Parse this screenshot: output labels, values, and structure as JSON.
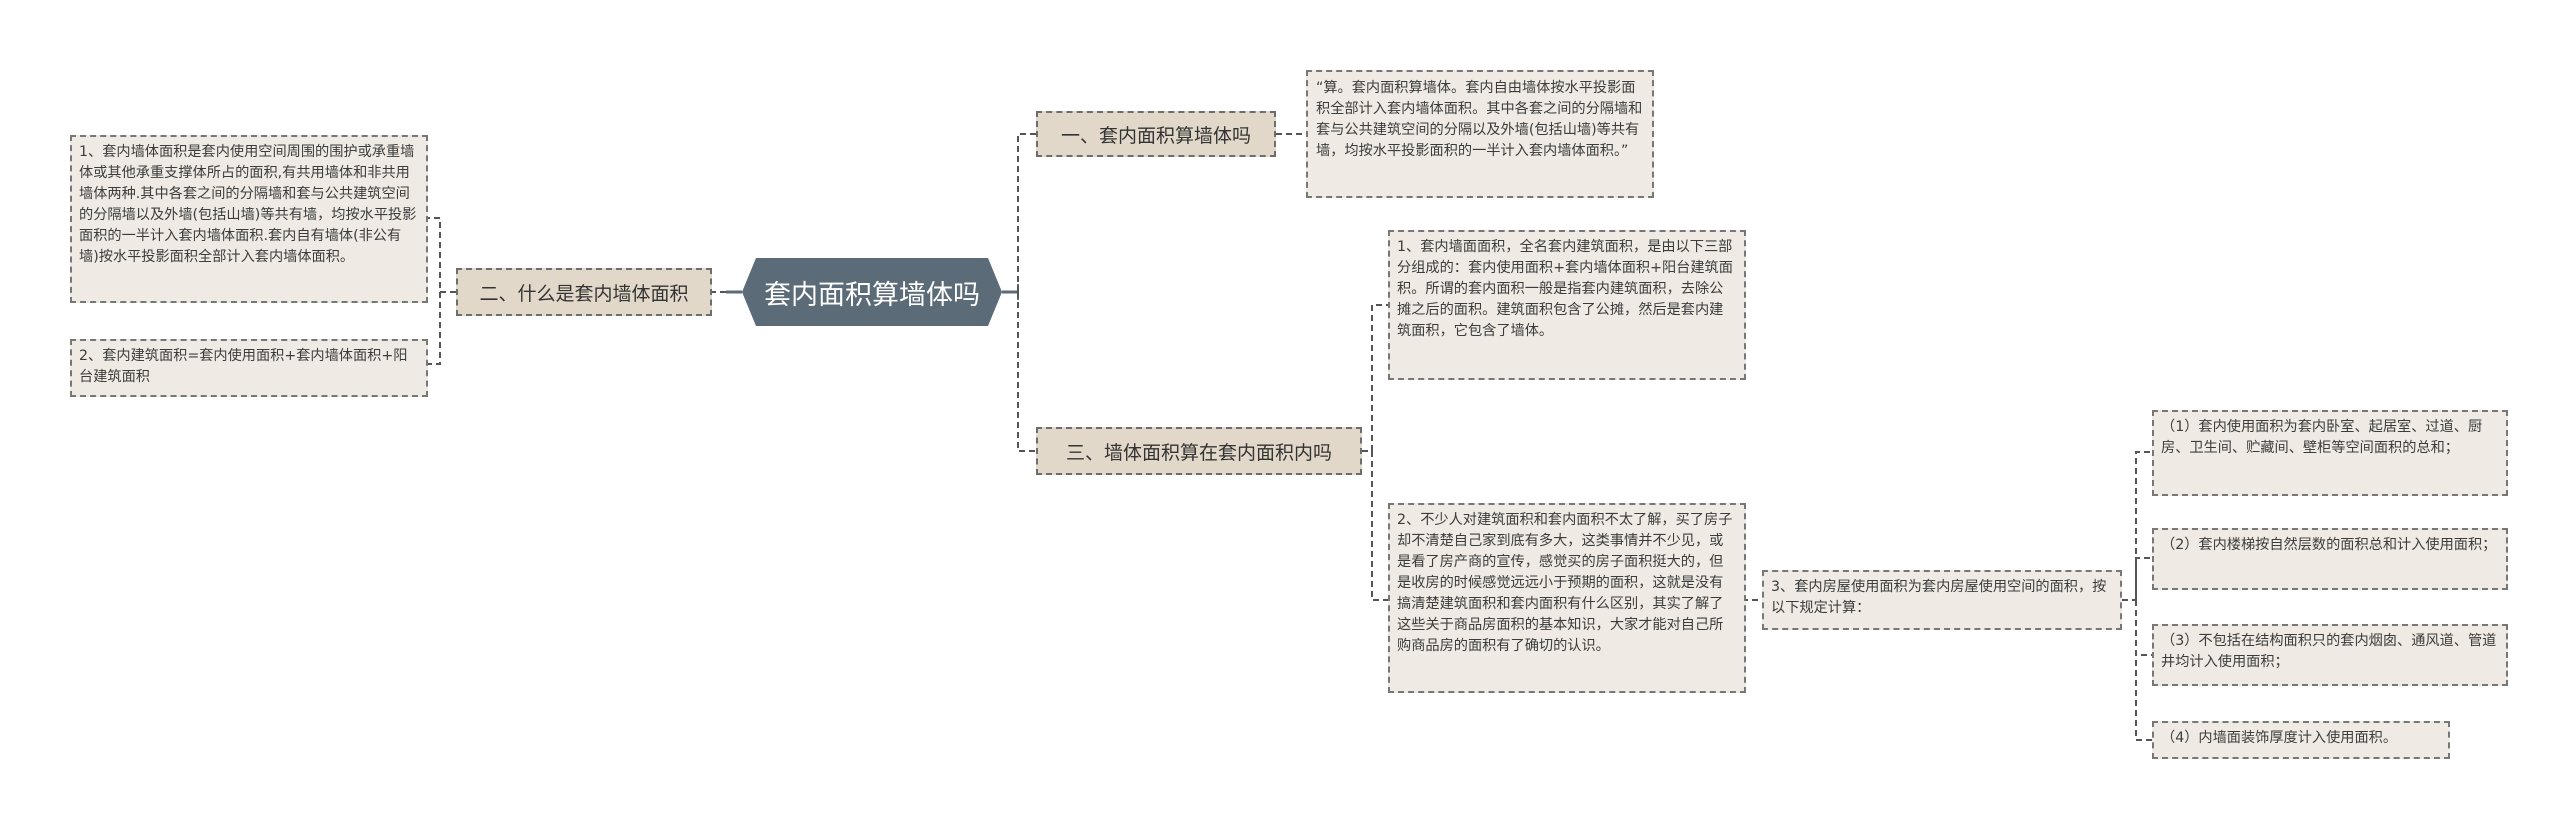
{
  "root": {
    "title": "套内面积算墙体吗",
    "color": "#5b6b77"
  },
  "branches": [
    {
      "id": "b1",
      "label": "一、套内面积算墙体吗",
      "children": [
        {
          "text": "“算。套内面积算墙体。套内自由墙体按水平投影面积全部计入套内墙体面积。其中各套之间的分隔墙和套与公共建筑空间的分隔以及外墙(包括山墙)等共有墙，均按水平投影面积的一半计入套内墙体面积。”"
        }
      ]
    },
    {
      "id": "b2",
      "label": "二、什么是套内墙体面积",
      "children": [
        {
          "text": "1、套内墙体面积是套内使用空间周围的围护或承重墙体或其他承重支撑体所占的面积,有共用墙体和非共用墙体两种.其中各套之间的分隔墙和套与公共建筑空间的分隔墙以及外墙(包括山墙)等共有墙，均按水平投影面积的一半计入套内墙体面积.套内自有墙体(非公有墙)按水平投影面积全部计入套内墙体面积。"
        },
        {
          "text": "2、套内建筑面积=套内使用面积+套内墙体面积+阳台建筑面积"
        }
      ]
    },
    {
      "id": "b3",
      "label": "三、墙体面积算在套内面积内吗",
      "children": [
        {
          "text": "1、套内墙面面积，全名套内建筑面积，是由以下三部分组成的：套内使用面积+套内墙体面积+阳台建筑面积。所谓的套内面积一般是指套内建筑面积，去除公摊之后的面积。建筑面积包含了公摊，然后是套内建筑面积，它包含了墙体。"
        },
        {
          "text": "2、不少人对建筑面积和套内面积不太了解，买了房子却不清楚自己家到底有多大，这类事情并不少见，或是看了房产商的宣传，感觉买的房子面积挺大的，但是收房的时候感觉远远小于预期的面积，这就是没有搞清楚建筑面积和套内面积有什么区别，其实了解了这些关于商品房面积的基本知识，大家才能对自己所购商品房的面积有了确切的认识。",
          "children": [
            {
              "text": "3、套内房屋使用面积为套内房屋使用空间的面积，按以下规定计算：",
              "children": [
                {
                  "text": "（1）套内使用面积为套内卧室、起居室、过道、厨房、卫生间、贮藏间、壁柜等空间面积的总和；"
                },
                {
                  "text": "（2）套内楼梯按自然层数的面积总和计入使用面积；"
                },
                {
                  "text": "（3）不包括在结构面积只的套内烟囱、通风道、管道井均计入使用面积；"
                },
                {
                  "text": "（4）内墙面装饰厚度计入使用面积。"
                }
              ]
            }
          ]
        }
      ]
    }
  ]
}
